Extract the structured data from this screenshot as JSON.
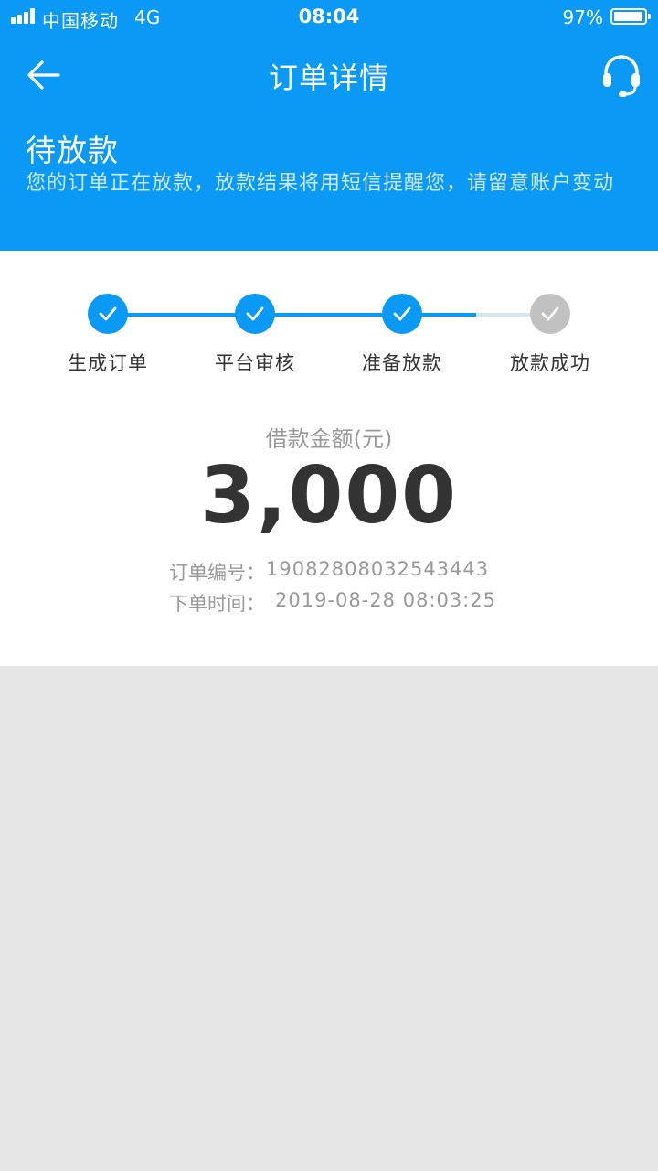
{
  "status_bar": {
    "carrier": "中国移动",
    "network": "4G",
    "time": "08:04",
    "battery": "97%"
  },
  "nav": {
    "title": "订单详情",
    "back_icon": "arrow-left-icon",
    "service_icon": "headset-icon"
  },
  "order_status": {
    "title": "待放款",
    "description": "您的订单正在放款，放款结果将用短信提醒您，请留意账户变动"
  },
  "progress": {
    "current_step": 3,
    "total_steps": 4,
    "steps": [
      {
        "label": "生成订单",
        "done": true
      },
      {
        "label": "平台审核",
        "done": true
      },
      {
        "label": "准备放款",
        "done": true
      },
      {
        "label": "放款成功",
        "done": false
      }
    ]
  },
  "loan": {
    "amount_label": "借款金额(元)",
    "amount": "3,000"
  },
  "order_info": {
    "number_label": "订单编号：",
    "number": "19082808032543443",
    "time_label": "下单时间：",
    "time": "2019-08-28 08:03:25"
  },
  "colors": {
    "primary": "#0a99f5",
    "inactive": "#c1c1c1",
    "track_inactive": "#d7e5ee",
    "text_dark": "#333333",
    "text_gray": "#999999",
    "page_bg": "#e6e6e6"
  }
}
